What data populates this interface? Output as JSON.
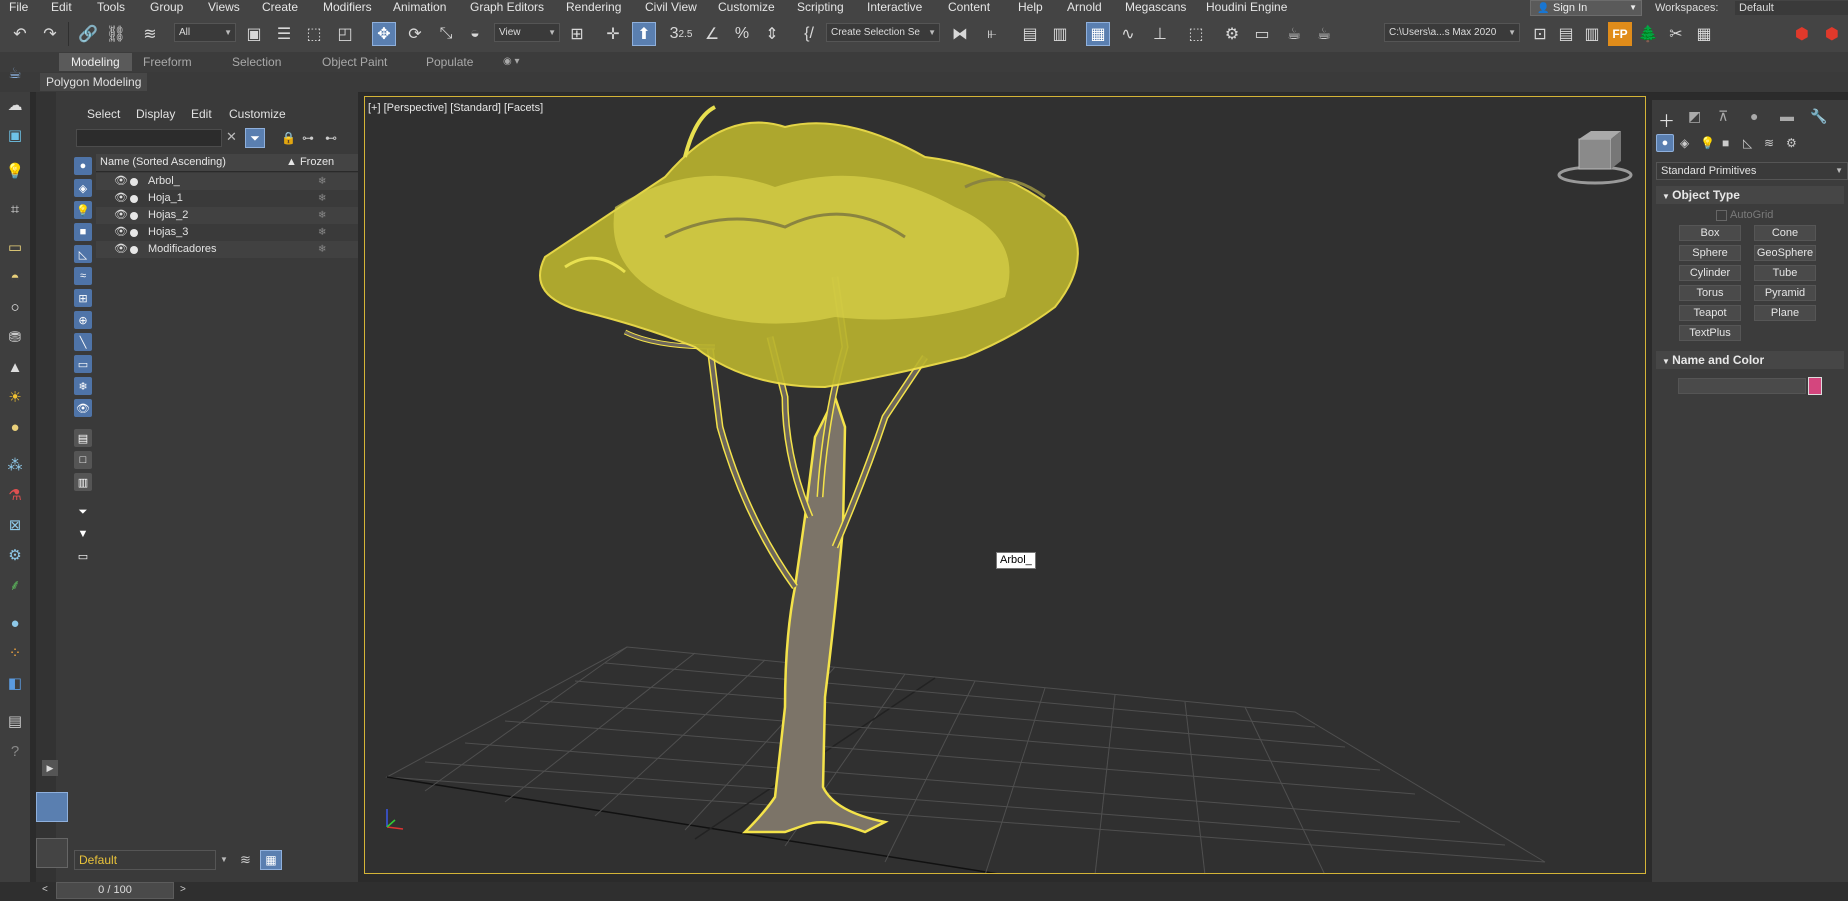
{
  "menu": [
    "File",
    "Edit",
    "Tools",
    "Group",
    "Views",
    "Create",
    "Modifiers",
    "Animation",
    "Graph Editors",
    "Rendering",
    "Civil View",
    "Customize",
    "Scripting",
    "Interactive",
    "Content",
    "Help",
    "Arnold",
    "Megascans",
    "Houdini Engine"
  ],
  "sign_in": "Sign In",
  "workspaces_label": "Workspaces:",
  "workspace_value": "Default",
  "toolbar": {
    "selection_filter": "All",
    "ref_coord": "View",
    "named_selection": "Create Selection Se",
    "project_path": "C:\\Users\\a...s Max 2020"
  },
  "ribbon_tabs": [
    "Modeling",
    "Freeform",
    "Selection",
    "Object Paint",
    "Populate"
  ],
  "ribbon_active": "Modeling",
  "ribbon_sub": "Polygon Modeling",
  "explorer": {
    "menu": [
      "Select",
      "Display",
      "Edit",
      "Customize"
    ],
    "search_value": "",
    "col_name": "Name (Sorted Ascending)",
    "col_frozen": "▲ Frozen",
    "rows": [
      "Arbol_",
      "Hoja_1",
      "Hojas_2",
      "Hojas_3",
      "Modificadores"
    ],
    "layer": "Default"
  },
  "viewport": {
    "label": "[+] [Perspective] [Standard] [Facets]",
    "tooltip": "Arbol_"
  },
  "command_panel": {
    "category": "Standard Primitives",
    "object_type_title": "Object Type",
    "autogrid": "AutoGrid",
    "primitives": [
      "Box",
      "Cone",
      "Sphere",
      "GeoSphere",
      "Cylinder",
      "Tube",
      "Torus",
      "Pyramid",
      "Teapot",
      "Plane",
      "TextPlus"
    ],
    "name_color_title": "Name and Color",
    "swatch_color": "#d4467e"
  },
  "timeline": "0 / 100",
  "colors": {
    "accent": "#5a7fb0",
    "selection": "#f4e34a",
    "viewport_border": "#d4b437"
  }
}
